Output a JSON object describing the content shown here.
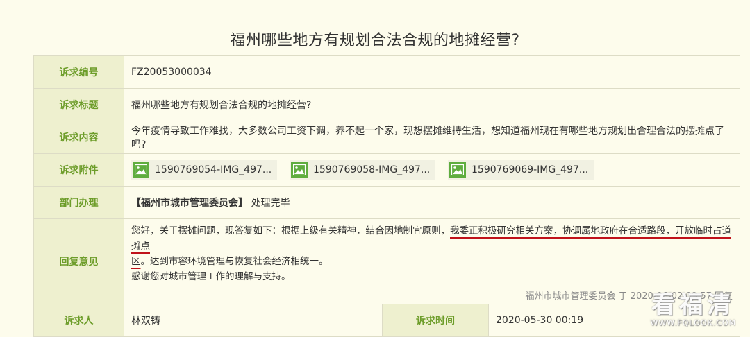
{
  "title": "福州哪些地方有规划合法合规的地摊经营?",
  "rows": {
    "id": {
      "label": "诉求编号",
      "value": "FZ20053000034"
    },
    "subject": {
      "label": "诉求标题",
      "value": "福州哪些地方有规划合法合规的地摊经营?"
    },
    "content": {
      "label": "诉求内容",
      "value": "今年疫情导致工作难找，大多数公司工资下调，养不起一个家，现想摆摊维持生活，想知道福州现在有哪些地方规划出合理合法的摆摊点了吗?"
    },
    "attachments": {
      "label": "诉求附件",
      "files": [
        "1590769054-IMG_497...",
        "1590769058-IMG_497...",
        "1590769069-IMG_497..."
      ]
    },
    "department": {
      "label": "部门办理",
      "dept": "【福州市城市管理委员会】",
      "status": "处理完毕"
    },
    "reply": {
      "label": "回复意见",
      "part1": "您好，关于摆摊问题，现答复如下：根据上级有关精神，结合因地制宜原则，",
      "part2": "我委正积极研究相关方案，协调属地政府在合适路段，开放临时占道摊点",
      "part3": "区",
      "part4": "。达到市容环境管理与恢复社会经济相统一。",
      "line2": "感谢您对城市管理工作的理解与支持。",
      "meta": "福州市城市管理委员会 于 2020-06-02 09:57 回复"
    },
    "requester": {
      "label": "诉求人",
      "value": "林双铸"
    },
    "time": {
      "label": "诉求时间",
      "value": "2020-05-30 00:19"
    }
  },
  "watermark": {
    "big": "看福清",
    "small": "WWW.FQLOOK.COM"
  },
  "colors": {
    "label_bg": "#eef0cf",
    "label_text": "#6d9d2a",
    "page_bg": "#fdfcec",
    "icon": "#5fad3f",
    "underline": "#c0121a"
  }
}
